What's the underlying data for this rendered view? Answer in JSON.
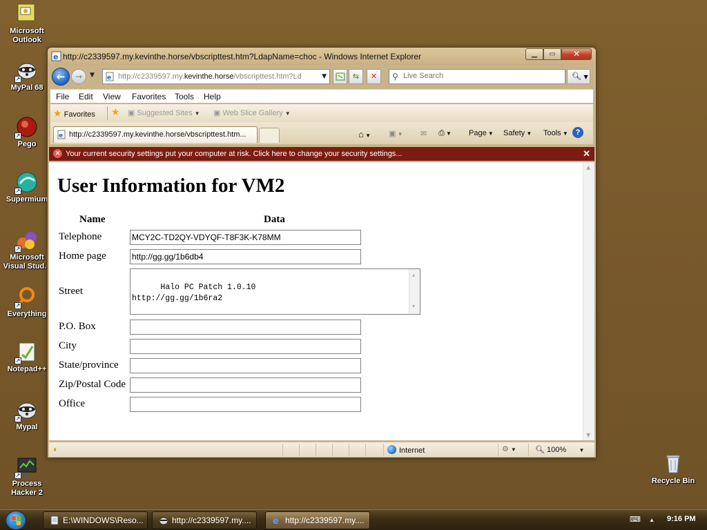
{
  "desktop": {
    "icons": [
      {
        "label": "Microsoft Outlook"
      },
      {
        "label": "MyPal 68"
      },
      {
        "label": "Pego"
      },
      {
        "label": "Supermium"
      },
      {
        "label": "Microsoft Visual Stud..."
      },
      {
        "label": "Everything"
      },
      {
        "label": "Notepad++"
      },
      {
        "label": "Mypal"
      },
      {
        "label": "Process Hacker 2"
      },
      {
        "label": "Recycle Bin"
      }
    ]
  },
  "window": {
    "title": "http://c2339597.my.kevinthe.horse/vbscripttest.htm?LdapName=choc - Windows Internet Explorer",
    "address": {
      "prefix": "http://c2339597.my.",
      "domain": "kevinthe.horse",
      "suffix": "/vbscripttest.htm?Ld"
    },
    "search_placeholder": "Live Search",
    "menu": [
      "File",
      "Edit",
      "View",
      "Favorites",
      "Tools",
      "Help"
    ],
    "favorites_label": "Favorites",
    "favorites_items": [
      "Suggested Sites",
      "Web Slice Gallery"
    ],
    "tab_label": "http://c2339597.my.kevinthe.horse/vbscripttest.htm...",
    "commands": {
      "page": "Page",
      "safety": "Safety",
      "tools": "Tools"
    },
    "info_bar": "Your current security settings put your computer at risk. Click here to change your security settings...",
    "status": {
      "zone": "Internet",
      "zoom": "100%"
    }
  },
  "page": {
    "heading": "User Information for VM2",
    "col_name": "Name",
    "col_data": "Data",
    "fields": {
      "telephone": {
        "label": "Telephone",
        "value": "MCY2C-TD2QY-VDYQF-T8F3K-K78MM"
      },
      "homepage": {
        "label": "Home page",
        "value": "http://gg.gg/1b6db4"
      },
      "street": {
        "label": "Street",
        "value": "Halo PC Patch 1.0.10\nhttp://gg.gg/1b6ra2"
      },
      "pobox": {
        "label": "P.O. Box",
        "value": ""
      },
      "city": {
        "label": "City",
        "value": ""
      },
      "state": {
        "label": "State/province",
        "value": ""
      },
      "zip": {
        "label": "Zip/Postal Code",
        "value": ""
      },
      "office": {
        "label": "Office",
        "value": ""
      }
    }
  },
  "taskbar": {
    "buttons": [
      {
        "label": "E:\\WINDOWS\\Reso..."
      },
      {
        "label": "http://c2339597.my...."
      },
      {
        "label": "http://c2339597.my...."
      }
    ],
    "clock": "9:16 PM"
  }
}
